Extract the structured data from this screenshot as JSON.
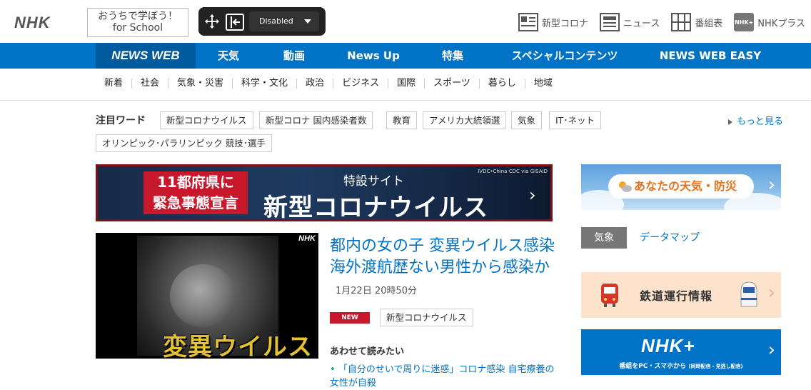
{
  "header": {
    "logo": "NHK",
    "school_line1": "おうちで学ぼう！",
    "school_line2": "for School",
    "toolbar": {
      "select_value": "Disabled"
    },
    "links": [
      {
        "label": "新型コロナ",
        "icon": "corona-icon"
      },
      {
        "label": "ニュース",
        "icon": "news-icon"
      },
      {
        "label": "番組表",
        "icon": "grid-icon"
      },
      {
        "label": "NHKプラス",
        "icon": "nhk-plus-icon",
        "badge": "NHK+"
      }
    ]
  },
  "nav": {
    "items": [
      "NEWS WEB",
      "天気",
      "動画",
      "News Up",
      "特集",
      "スペシャルコンテンツ",
      "NEWS WEB EASY"
    ]
  },
  "subnav": {
    "items": [
      "新着",
      "社会",
      "気象・災害",
      "科学・文化",
      "政治",
      "ビジネス",
      "国際",
      "スポーツ",
      "暮らし",
      "地域"
    ]
  },
  "tags": {
    "label": "注目ワード",
    "items": [
      "新型コロナウイルス",
      "新型コロナ 国内感染者数",
      "教育",
      "アメリカ大統領選",
      "気象",
      "IT･ネット",
      "オリンピック･パラリンピック 競技･選手"
    ],
    "more": "もっと見る"
  },
  "banner": {
    "emergency_line1": "11都府県に",
    "emergency_line2": "緊急事態宣言",
    "sub": "特設サイト",
    "title": "新型コロナウイルス",
    "credit": "IVDC•China CDC via GISAID"
  },
  "story": {
    "image_overlay": "変異ウイルス",
    "image_wm": "NHK",
    "headline": "都内の女の子 変異ウイルス感染 海外渡航歴ない男性から感染か",
    "time": "1月22日 20時50分",
    "badge": "NEW",
    "tag": "新型コロナウイルス",
    "related_header": "あわせて読みたい",
    "related_link": "「自分のせいで周りに迷惑」コロナ感染 自宅療養の女性が自殺"
  },
  "sidebar": {
    "weather": "あなたの天気・防災",
    "kisho": "気象",
    "datamap": "データマップ",
    "rail": "鉄道運行情報",
    "plus_logo": "NHK+",
    "plus_sub": "番組をPC・スマホから",
    "plus_sub_small": "(同時配信・見逃し配信)"
  },
  "colors": {
    "brand_blue": "#0073c7",
    "nav_active": "#005a9e",
    "red": "#c8182b",
    "rail_bg": "#fde3cb"
  }
}
